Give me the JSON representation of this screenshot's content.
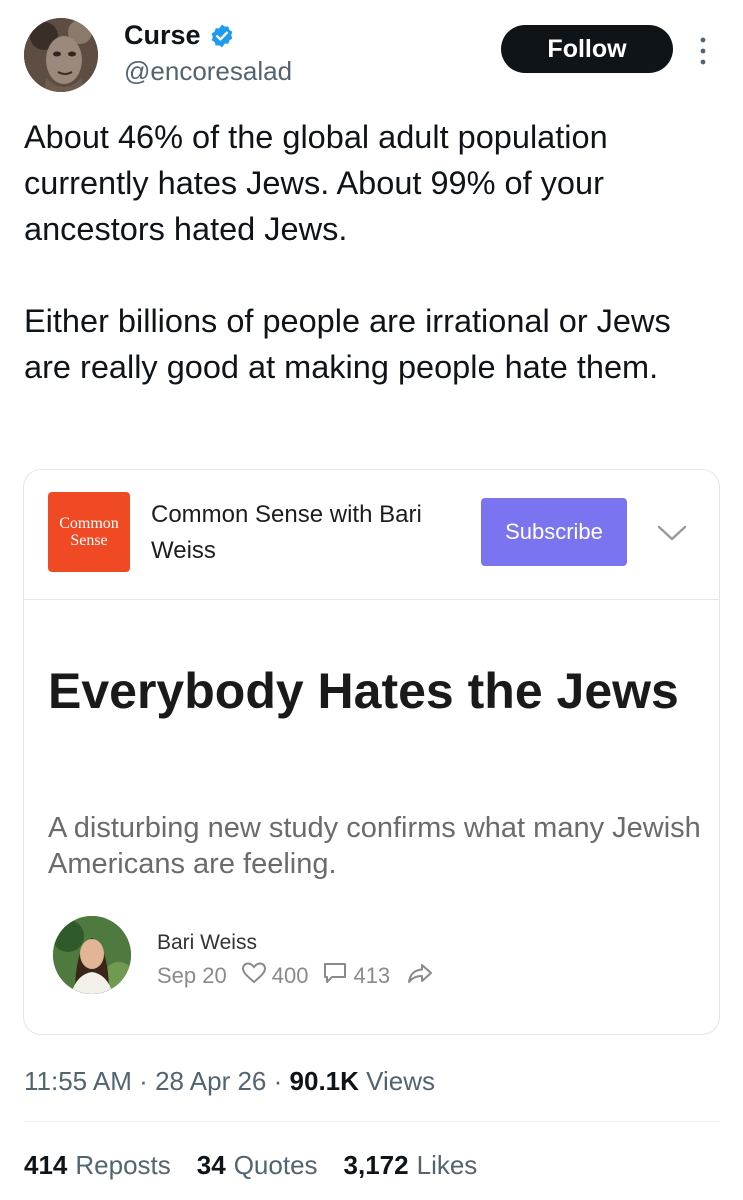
{
  "user": {
    "display_name": "Curse",
    "handle": "@encoresalad",
    "verified": true,
    "follow_label": "Follow",
    "avatar_icon": "statue-face-avatar",
    "more_icon": "vertical-dots-icon"
  },
  "tweet": {
    "paragraphs": [
      "About 46% of the global adult population currently hates Jews. About 99% of your ancestors hated Jews.",
      "Either billions of people are irrational or Jews are really good at making people hate them."
    ]
  },
  "card": {
    "publication_logo_lines": [
      "Common",
      "Sense"
    ],
    "publication_name": "Common Sense with Bari Weiss",
    "subscribe_label": "Subscribe",
    "article_title": "Everybody Hates the Jews",
    "article_subtitle": "A disturbing new study confirms what many Jewish Americans are feeling.",
    "author_name": "Bari Weiss",
    "date": "Sep 20",
    "likes": "400",
    "comments": "413",
    "colors": {
      "logo_bg": "#f04a24",
      "subscribe_bg": "#7b74f0"
    }
  },
  "meta": {
    "time": "11:55 AM",
    "separator": "·",
    "date": "28 Apr 26",
    "views_count": "90.1K",
    "views_label": "Views"
  },
  "stats": {
    "reposts_count": "414",
    "reposts_label": "Reposts",
    "quotes_count": "34",
    "quotes_label": "Quotes",
    "likes_count": "3,172",
    "likes_label": "Likes"
  }
}
